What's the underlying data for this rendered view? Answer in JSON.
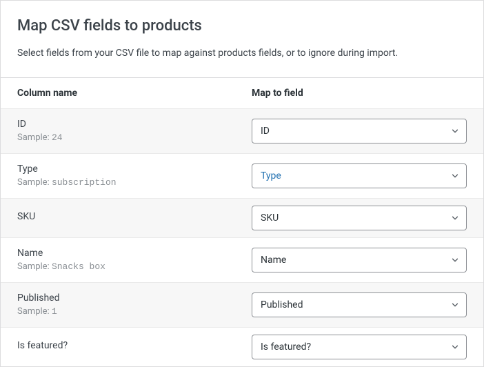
{
  "header": {
    "title": "Map CSV fields to products",
    "subtitle": "Select fields from your CSV file to map against products fields, or to ignore during import."
  },
  "table": {
    "columnNameHeader": "Column name",
    "mapToFieldHeader": "Map to field",
    "sampleLabel": "Sample:"
  },
  "rows": [
    {
      "name": "ID",
      "sample": "24",
      "mapTo": "ID",
      "hasSample": true,
      "striped": true,
      "active": false
    },
    {
      "name": "Type",
      "sample": "subscription",
      "mapTo": "Type",
      "hasSample": true,
      "striped": false,
      "active": true
    },
    {
      "name": "SKU",
      "sample": "",
      "mapTo": "SKU",
      "hasSample": false,
      "striped": true,
      "active": false
    },
    {
      "name": "Name",
      "sample": "Snacks box",
      "mapTo": "Name",
      "hasSample": true,
      "striped": false,
      "active": false
    },
    {
      "name": "Published",
      "sample": "1",
      "mapTo": "Published",
      "hasSample": true,
      "striped": true,
      "active": false
    },
    {
      "name": "Is featured?",
      "sample": "",
      "mapTo": "Is featured?",
      "hasSample": false,
      "striped": false,
      "active": false
    }
  ]
}
